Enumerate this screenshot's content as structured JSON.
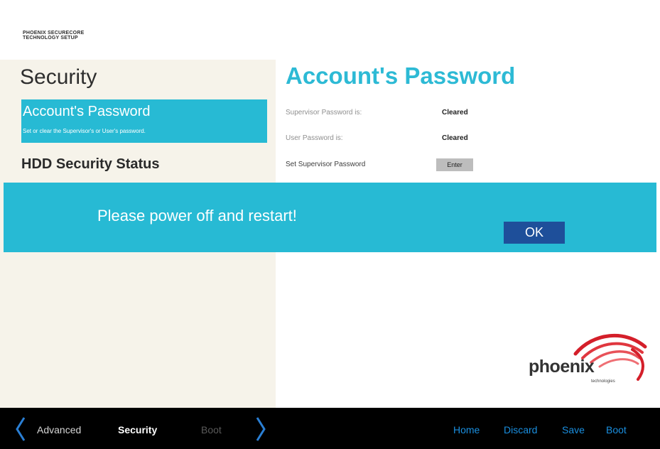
{
  "vendor": {
    "line1": "PHOENIX SECURECORE",
    "line2": "TECHNOLOGY SETUP"
  },
  "left": {
    "section_title": "Security",
    "items": [
      {
        "label": "Account's Password",
        "description": "Set or clear the Supervisor's or User's password.",
        "selected": true
      },
      {
        "label": "HDD Security Status",
        "selected": false
      }
    ]
  },
  "right": {
    "title": "Account's Password",
    "settings": [
      {
        "label": "Supervisor Password is:",
        "value": "Cleared"
      },
      {
        "label": "User Password is:",
        "value": "Cleared"
      },
      {
        "label": "Set Supervisor Password",
        "button": "Enter"
      }
    ]
  },
  "dialog": {
    "message": "Please power off and restart!",
    "ok_label": "OK"
  },
  "logo": {
    "word": "phoenix",
    "sub": "technologies"
  },
  "bottom": {
    "tabs": [
      "Advanced",
      "Security",
      "Boot"
    ],
    "actions": [
      "Home",
      "Discard",
      "Save",
      "Boot"
    ]
  },
  "colors": {
    "accent": "#27bad4",
    "ok_button": "#1e4f9a",
    "left_panel": "#f6f3ea",
    "bar": "#000000",
    "action_link": "#1a8fe0"
  }
}
